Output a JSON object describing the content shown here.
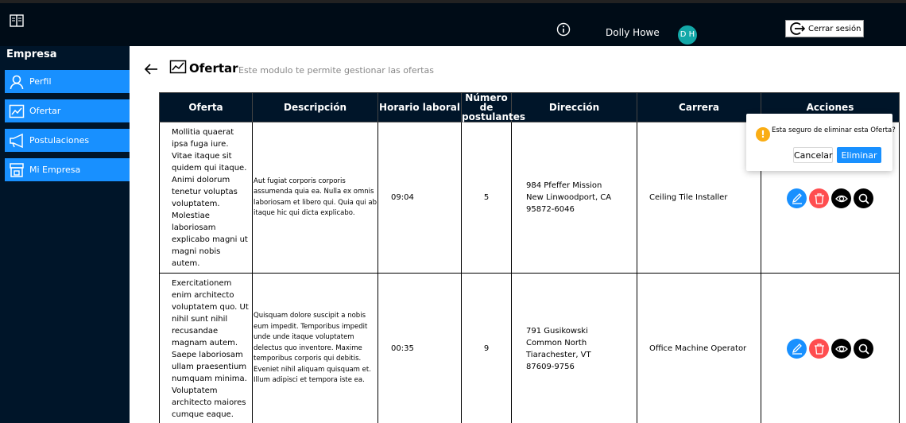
{
  "header": {
    "user_name": "Dolly Howe",
    "avatar_initials": "D H",
    "logout_label": "Cerrar sesión",
    "info_icon": "info-circle-icon",
    "logo_icon": "book-icon"
  },
  "sidebar": {
    "title": "Empresa",
    "items": [
      {
        "label": "Perfil",
        "icon": "user-icon"
      },
      {
        "label": "Ofertar",
        "icon": "line-chart-icon"
      },
      {
        "label": "Postulaciones",
        "icon": "megaphone-icon"
      },
      {
        "label": "Mi Empresa",
        "icon": "shop-icon"
      }
    ]
  },
  "page": {
    "title": "Ofertar",
    "subtitle": "Este modulo te permite gestionar las ofertas"
  },
  "table": {
    "columns": [
      "Oferta",
      "Descripción",
      "Horario laboral",
      "Número de postulantes",
      "Dirección",
      "Carrera",
      "Acciones"
    ],
    "rows": [
      {
        "oferta": "Mollitia quaerat ipsa fuga iure. Vitae itaque sit quidem qui itaque. Animi dolorum tenetur voluptas voluptatem. Molestiae laboriosam explicabo magni ut magni nobis autem.",
        "descripcion": "Aut fugiat corporis corporis assumenda quia ea. Nulla ex omnis laboriosam et libero qui. Quia qui ab itaque hic qui dicta explicabo.",
        "horario": "09:04",
        "postulantes": "5",
        "direccion": "984 Pfeffer Mission New Linwoodport, CA 95872-6046",
        "carrera": "Ceiling Tile Installer"
      },
      {
        "oferta": "Exercitationem enim architecto voluptatem quo. Ut nihil sunt nihil recusandae magnam autem. Saepe laboriosam ullam praesentium numquam minima. Voluptatem architecto maiores cumque eaque.",
        "descripcion": "Quisquam dolore suscipit a nobis eum impedit. Temporibus impedit unde unde itaque voluptatem delectus quo inventore. Maxime temporibus corporis qui debitis. Eveniet nihil aliquam quisquam et. Illum adipisci et tempora iste ea.",
        "horario": "00:35",
        "postulantes": "9",
        "direccion": "791 Gusikowski Common North Tiarachester, VT 87609-9756",
        "carrera": "Office Machine Operator"
      }
    ]
  },
  "popconfirm": {
    "message": "Esta seguro de eliminar esta Oferta?",
    "cancel_label": "Cancelar",
    "ok_label": "Eliminar"
  },
  "colors": {
    "primary": "#1890ff",
    "danger": "#ff4d4f",
    "sidebar_bg": "#001529",
    "avatar_bg": "#13a8a8",
    "warning": "#faad14"
  }
}
